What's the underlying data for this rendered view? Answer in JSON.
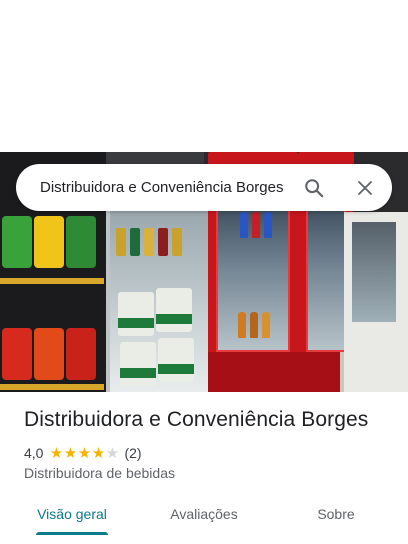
{
  "search": {
    "query": "Distribuidora e Conveniência Borges",
    "search_icon": "search-icon",
    "close_icon": "close-icon"
  },
  "hero": {
    "image_icon": "place-photo"
  },
  "place": {
    "name": "Distribuidora e Conveniência Borges",
    "rating": "4,0",
    "stars_filled": 4,
    "stars_total": 5,
    "review_count": "(2)",
    "category": "Distribuidora de bebidas"
  },
  "tabs": [
    {
      "label": "Visão geral",
      "active": true
    },
    {
      "label": "Avaliações",
      "active": false
    },
    {
      "label": "Sobre",
      "active": false
    }
  ],
  "colors": {
    "accent": "#0b7a8a",
    "star": "#f5b400",
    "star_empty": "#d5d7da"
  }
}
